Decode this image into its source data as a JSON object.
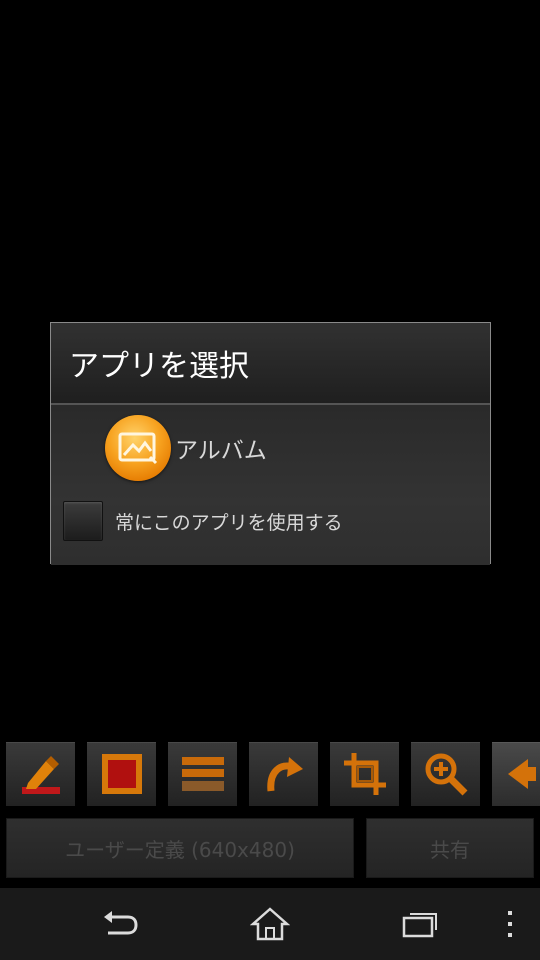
{
  "dialog": {
    "title": "アプリを選択",
    "app": {
      "label": "アルバム",
      "icon": "album-icon"
    },
    "always_use_label": "常にこのアプリを使用する",
    "always_use_checked": false
  },
  "toolbar": {
    "tools": [
      {
        "icon": "edit-pencil-icon"
      },
      {
        "icon": "frame-square-icon"
      },
      {
        "icon": "layers-icon"
      },
      {
        "icon": "rotate-icon"
      },
      {
        "icon": "crop-icon"
      },
      {
        "icon": "zoom-in-icon"
      },
      {
        "icon": "arrow-left-icon"
      }
    ]
  },
  "buttons": {
    "size_label": "ユーザー定義 (640x480)",
    "share_label": "共有"
  },
  "navbar": {
    "back_icon": "back-icon",
    "home_icon": "home-icon",
    "recents_icon": "recent-apps-icon",
    "menu_icon": "overflow-menu-icon"
  },
  "colors": {
    "accent_orange": "#e87a00",
    "dialog_bg": "#2d2d2d",
    "background": "#000000"
  }
}
